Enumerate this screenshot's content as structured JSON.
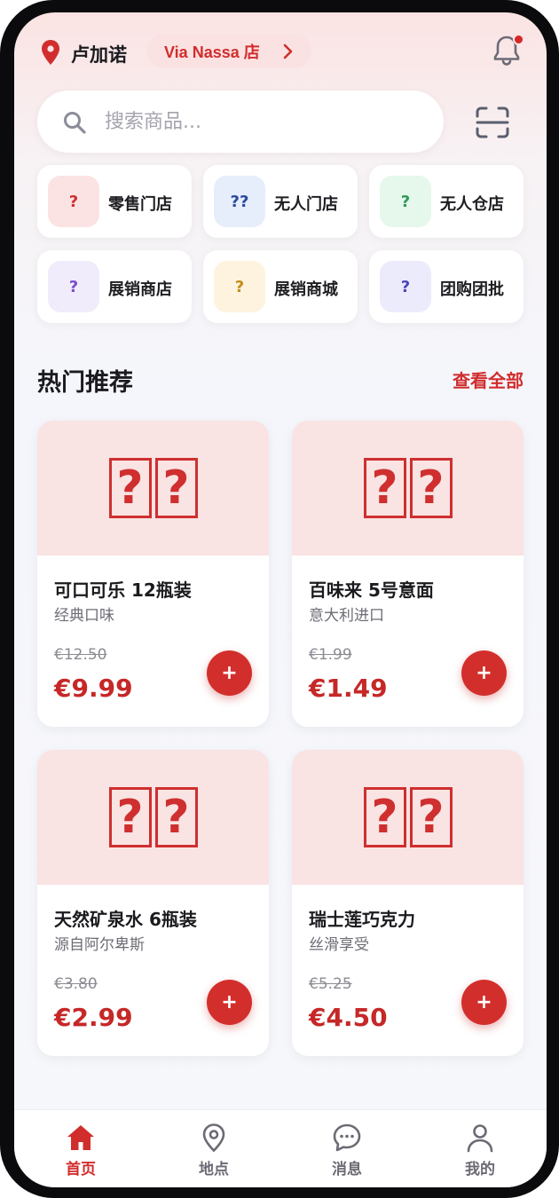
{
  "header": {
    "city": "卢加诺",
    "store": "Via Nassa 店",
    "has_notification": true
  },
  "search": {
    "placeholder": "搜索商品..."
  },
  "categories": [
    {
      "label": "零售门店",
      "icon": "?",
      "bg": "#fbe3e3",
      "color": "#cf2f2f"
    },
    {
      "label": "无人门店",
      "icon": "??",
      "bg": "#e6eefb",
      "color": "#2a4aa0"
    },
    {
      "label": "无人仓店",
      "icon": "?",
      "bg": "#e6f7ec",
      "color": "#2e9a58"
    },
    {
      "label": "展销商店",
      "icon": "?",
      "bg": "#f1ecfb",
      "color": "#7a4fc9"
    },
    {
      "label": "展销商城",
      "icon": "?",
      "bg": "#fdf3df",
      "color": "#c68d1a"
    },
    {
      "label": "团购团批",
      "icon": "?",
      "bg": "#ecebfb",
      "color": "#4b46b8"
    }
  ],
  "section": {
    "title": "热门推荐",
    "more": "查看全部"
  },
  "products": [
    {
      "name": "可口可乐 12瓶装",
      "subtitle": "经典口味",
      "old_price": "€12.50",
      "price": "€9.99",
      "image_glyph": "??"
    },
    {
      "name": "百味来 5号意面",
      "subtitle": "意大利进口",
      "old_price": "€1.99",
      "price": "€1.49",
      "image_glyph": "??"
    },
    {
      "name": "天然矿泉水 6瓶装",
      "subtitle": "源自阿尔卑斯",
      "old_price": "€3.80",
      "price": "€2.99",
      "image_glyph": "??"
    },
    {
      "name": "瑞士莲巧克力",
      "subtitle": "丝滑享受",
      "old_price": "€5.25",
      "price": "€4.50",
      "image_glyph": "??"
    }
  ],
  "add_label": "+",
  "tabs": [
    {
      "label": "首页",
      "icon": "home-icon",
      "active": true
    },
    {
      "label": "地点",
      "icon": "location-icon",
      "active": false
    },
    {
      "label": "消息",
      "icon": "chat-icon",
      "active": false
    },
    {
      "label": "我的",
      "icon": "user-icon",
      "active": false
    }
  ],
  "colors": {
    "accent": "#d12d2d",
    "price": "#c62828",
    "image_bg": "#f9e3e3"
  }
}
